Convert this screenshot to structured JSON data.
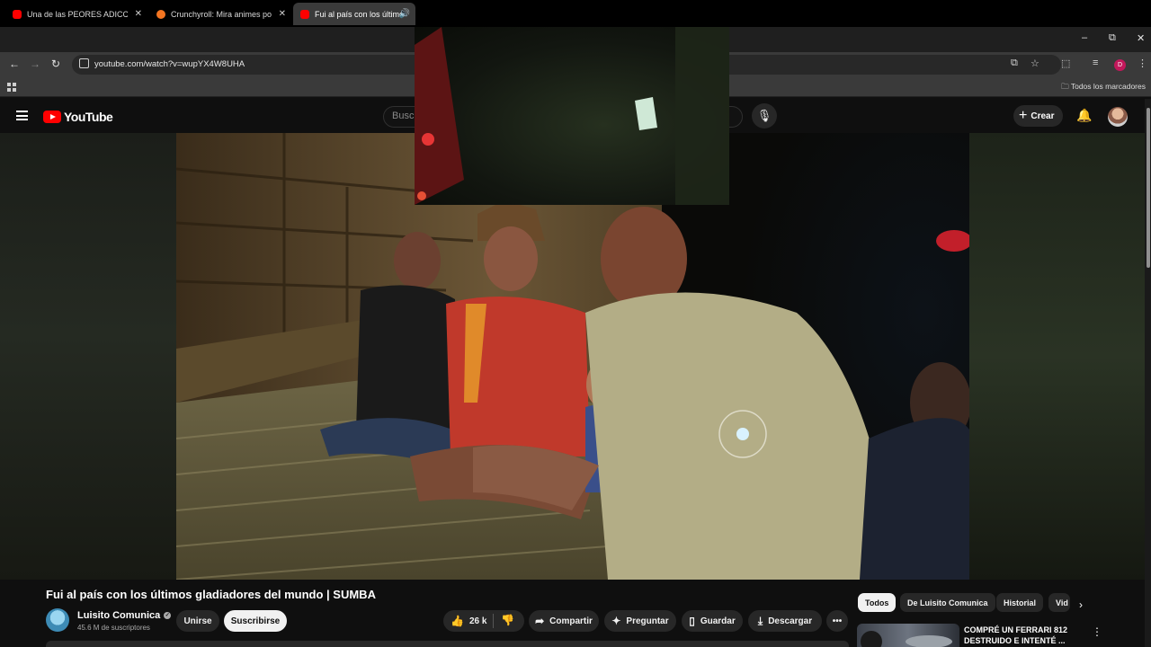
{
  "browser": {
    "tabs": [
      {
        "label": "Una de las PEORES ADICCIONES",
        "close": "✕"
      },
      {
        "label": "Crunchyroll: Mira animes popu",
        "close": "✕"
      },
      {
        "label": "Fui al país con los últimos g",
        "close": "🔊"
      }
    ],
    "url": "youtube.com/watch?v=wupYX4W8UHA",
    "bookmarks_all": "Todos los marcadores",
    "profile_initial": "D",
    "window_controls": {
      "minimize": "–",
      "maximize": "⧉",
      "close": "✕"
    }
  },
  "youtube": {
    "logo_text": "YouTube",
    "search_placeholder": "Busca",
    "create_label": "Crear"
  },
  "video": {
    "title": "Fui al país con los últimos gladiadores del mundo | SUMBA",
    "channel": "Luisito Comunica",
    "subscribers": "45.6 M de suscriptores",
    "join_label": "Unirse",
    "subscribe_label": "Suscribirse",
    "likes": "26 k",
    "share_label": "Compartir",
    "ask_label": "Preguntar",
    "save_label": "Guardar",
    "download_label": "Descargar",
    "more_label": "•••"
  },
  "recommendations": {
    "chips": [
      "Todos",
      "De Luisito Comunica",
      "Historial",
      "Vid"
    ],
    "selected_chip": "Todos",
    "items": [
      {
        "title": "COMPRÉ UN FERRARI 812 DESTRUIDO E INTENTÉ ..."
      }
    ]
  },
  "icons": {
    "back": "back-arrow-icon",
    "forward": "forward-arrow-icon",
    "reload": "reload-icon",
    "menu": "hamburger-menu-icon",
    "mic": "microphone-icon",
    "bell": "bell-icon",
    "like": "thumbs-up-icon",
    "dislike": "thumbs-down-icon"
  },
  "colors": {
    "yt_red": "#ff0000",
    "background": "#0f0f0f",
    "chip_bg": "#272727"
  }
}
